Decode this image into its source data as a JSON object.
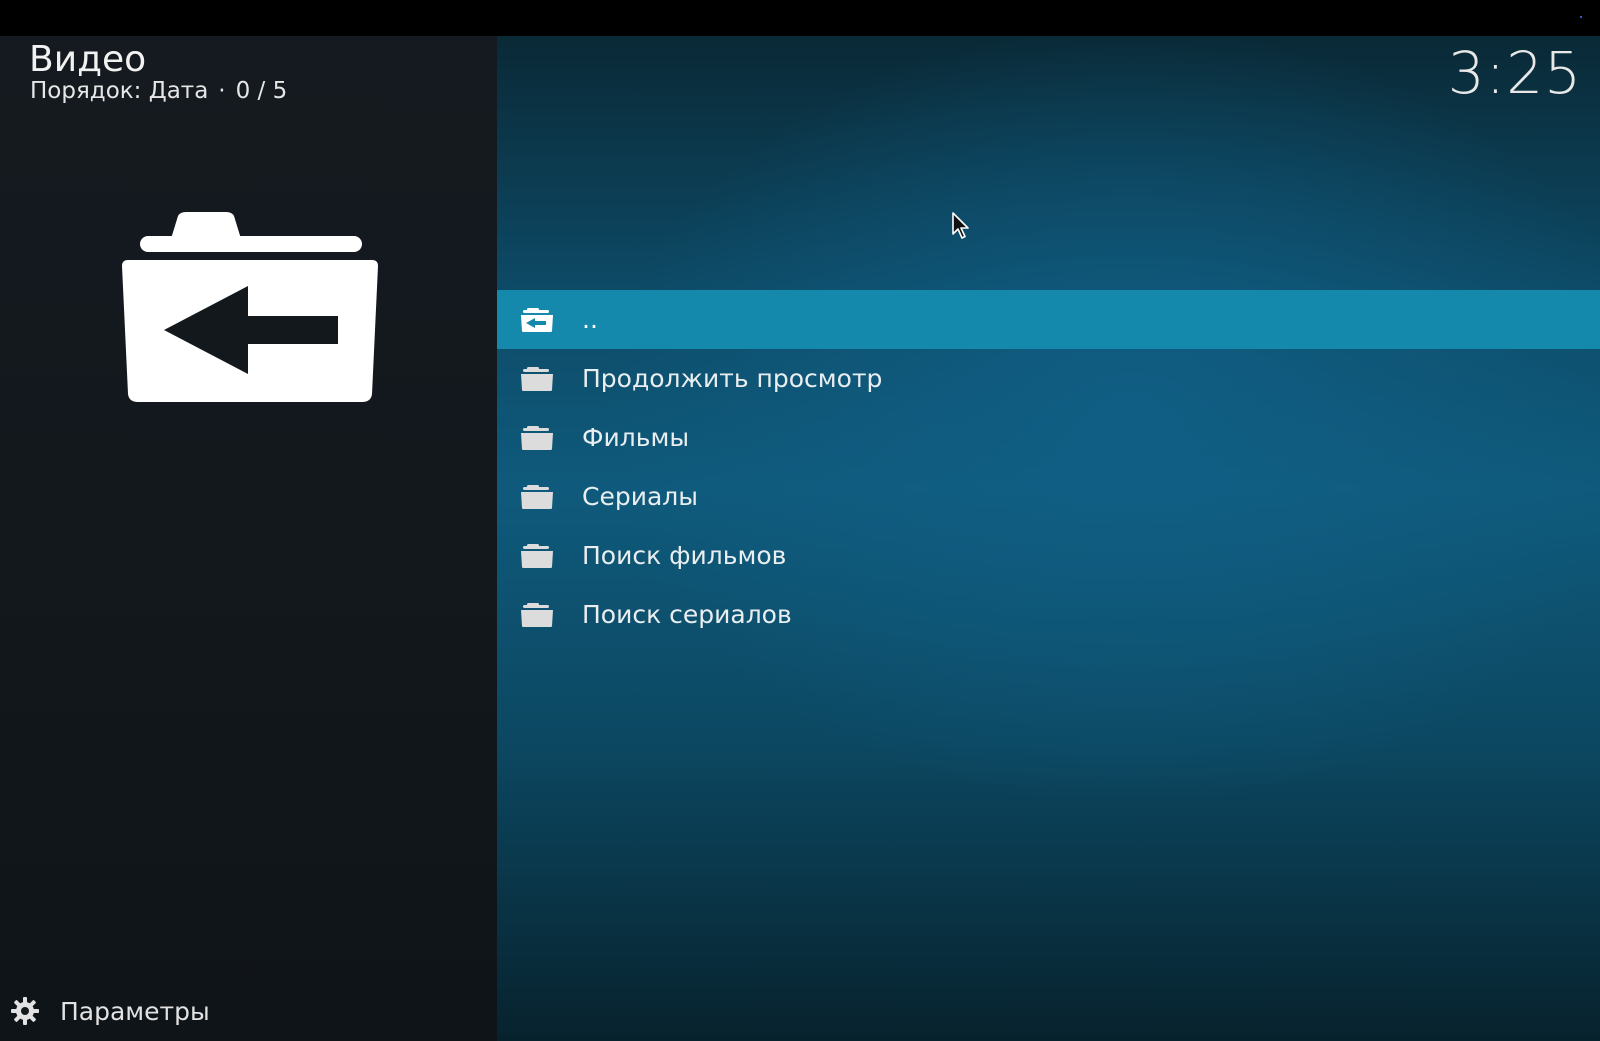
{
  "header": {
    "title": "Видео",
    "sort_label": "Порядок: Дата",
    "separator": "·",
    "counter": "0 / 5"
  },
  "clock": "3:25",
  "list": {
    "items": [
      {
        "label": "..",
        "icon": "folder-back-icon",
        "selected": true
      },
      {
        "label": "Продолжить просмотр",
        "icon": "folder-icon",
        "selected": false
      },
      {
        "label": "Фильмы",
        "icon": "folder-icon",
        "selected": false
      },
      {
        "label": "Сериалы",
        "icon": "folder-icon",
        "selected": false
      },
      {
        "label": "Поиск фильмов",
        "icon": "folder-icon",
        "selected": false
      },
      {
        "label": "Поиск сериалов",
        "icon": "folder-icon",
        "selected": false
      }
    ]
  },
  "preview": {
    "icon": "folder-back-icon"
  },
  "footer": {
    "settings_label": "Параметры",
    "settings_icon": "gear-icon"
  },
  "colors": {
    "selection": "#1489ab",
    "left_panel": "#12181c",
    "background_accent": "#0f5a7c"
  }
}
